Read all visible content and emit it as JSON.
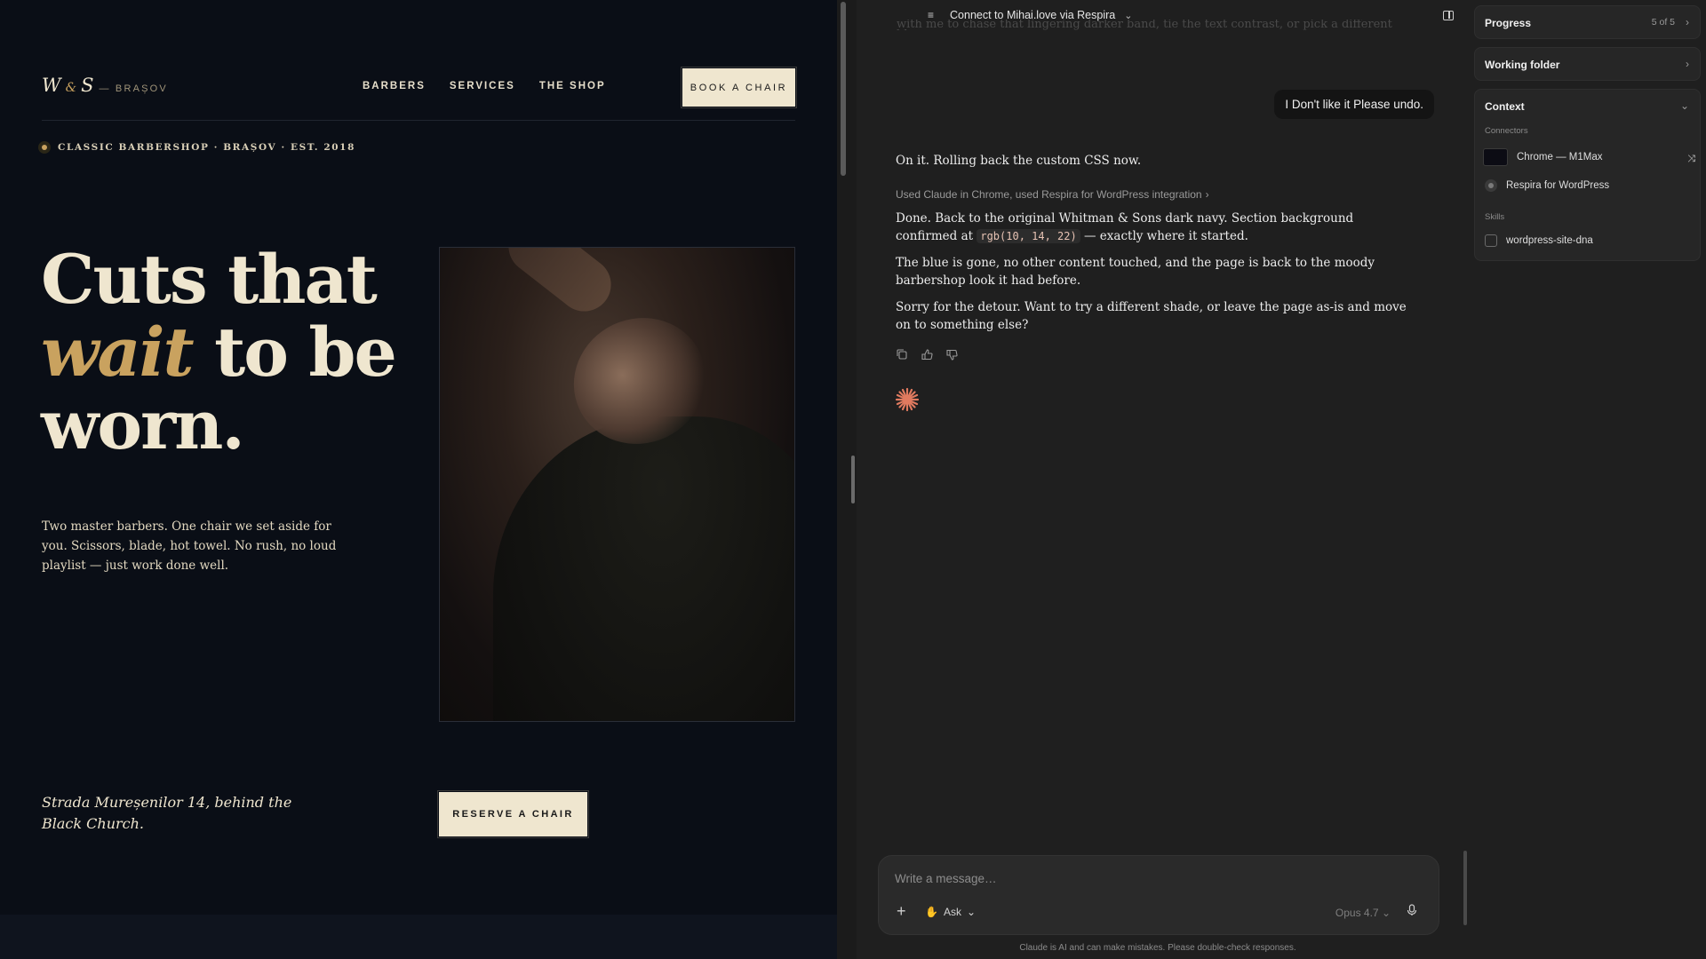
{
  "site": {
    "logo": {
      "mark_w": "W",
      "mark_amp": "&",
      "mark_s": "S",
      "city": "— BRAȘOV"
    },
    "nav": [
      "BARBERS",
      "SERVICES",
      "THE SHOP"
    ],
    "book_button": "BOOK A CHAIR",
    "eyebrow": "CLASSIC BARBERSHOP · BRAȘOV · EST. 2018",
    "headline": {
      "line1": "Cuts that",
      "accent": "wait",
      "line2_rest": " to be",
      "line3": "worn."
    },
    "lede": "Two master barbers. One chair we set aside for you. Scissors, blade, hot towel. No rush, no loud playlist — just work done well.",
    "address": "Strada Mureșenilor 14, behind the Black Church.",
    "reserve_button": "RESERVE A CHAIR",
    "colors": {
      "bg": "#0a0e16",
      "cream": "#efe6cf",
      "gold": "#c9a25f"
    }
  },
  "chat": {
    "header": {
      "title": "Connect to Mihai.love via Respira",
      "menu_icon": "list-icon",
      "chevron_icon": "chevron-down-icon",
      "panel_icon": "panel-toggle-icon"
    },
    "faded_text": "with me to chase that lingering darker band, tie the text contrast, or pick a different blue.",
    "user_message": "I Don't like it Please undo.",
    "assistant_intro": "On it. Rolling back the custom CSS now.",
    "tool_line": "Used Claude in Chrome, used Respira for WordPress integration",
    "para1_a": "Done. Back to the original Whitman & Sons dark navy. Section background confirmed at",
    "para1_code": "rgb(10, 14, 22)",
    "para1_b": " — exactly where it started.",
    "para2": "The blue is gone, no other content touched, and the page is back to the moody barbershop look it had before.",
    "para3": "Sorry for the detour. Want to try a different shade, or leave the page as-is and move on to something else?",
    "action_icons": [
      "copy-icon",
      "thumbs-up-icon",
      "thumbs-down-icon"
    ],
    "composer": {
      "placeholder": "Write a message…",
      "mode": "Ask",
      "model": "Opus 4.7"
    },
    "disclaimer": "Claude is AI and can make mistakes. Please double-check responses.",
    "colors": {
      "bg": "#1f1f1f",
      "accent": "#e07a5f"
    }
  },
  "side": {
    "progress": {
      "title": "Progress",
      "count": "5 of 5"
    },
    "working_folder": {
      "title": "Working folder"
    },
    "context": {
      "title": "Context",
      "connectors_label": "Connectors",
      "connectors": [
        "Chrome — M1Max",
        "Respira for WordPress"
      ],
      "skills_label": "Skills",
      "skills": [
        "wordpress-site-dna"
      ]
    }
  }
}
